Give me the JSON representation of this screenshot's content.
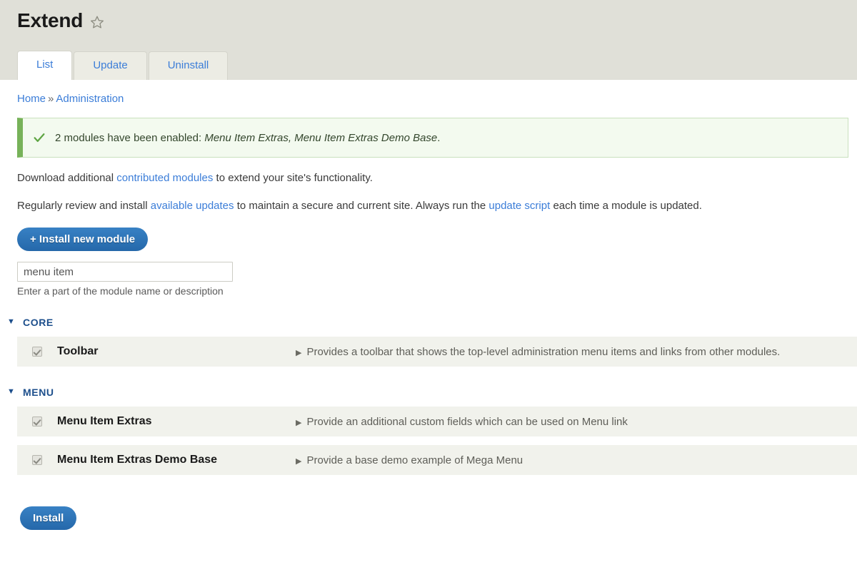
{
  "header": {
    "title": "Extend",
    "star_icon": "star-outline-icon",
    "tabs": [
      {
        "label": "List",
        "active": true
      },
      {
        "label": "Update",
        "active": false
      },
      {
        "label": "Uninstall",
        "active": false
      }
    ]
  },
  "breadcrumb": {
    "items": [
      "Home",
      "Administration"
    ],
    "separator": "»"
  },
  "status": {
    "icon": "check-icon",
    "prefix": "2 modules have been enabled: ",
    "modules": "Menu Item Extras, Menu Item Extras Demo Base",
    "suffix": ".",
    "accent_color": "#77b259",
    "background_color": "#f3faef"
  },
  "intro": {
    "line1_a": "Download additional ",
    "line1_link": "contributed modules",
    "line1_b": " to extend your site's functionality.",
    "line2_a": "Regularly review and install ",
    "line2_link1": "available updates",
    "line2_b": " to maintain a secure and current site. Always run the ",
    "line2_link2": "update script",
    "line2_c": " each time a module is updated."
  },
  "actions": {
    "install_new_module": "+ Install new module",
    "install_submit": "Install",
    "primary_color": "#2c73b8"
  },
  "filter": {
    "value": "menu item",
    "placeholder": "",
    "description": "Enter a part of the module name or description"
  },
  "groups": [
    {
      "caret": "▼",
      "name": "CORE",
      "modules": [
        {
          "checked": true,
          "disabled": true,
          "name": "Toolbar",
          "marker": "▶",
          "description": "Provides a toolbar that shows the top-level administration menu items and links from other modules."
        }
      ]
    },
    {
      "caret": "▼",
      "name": "MENU",
      "modules": [
        {
          "checked": true,
          "disabled": true,
          "name": "Menu Item Extras",
          "marker": "▶",
          "description": "Provide an additional custom fields which can be used on Menu link"
        },
        {
          "checked": true,
          "disabled": true,
          "name": "Menu Item Extras Demo Base",
          "marker": "▶",
          "description": "Provide a base demo example of Mega Menu"
        }
      ]
    }
  ]
}
